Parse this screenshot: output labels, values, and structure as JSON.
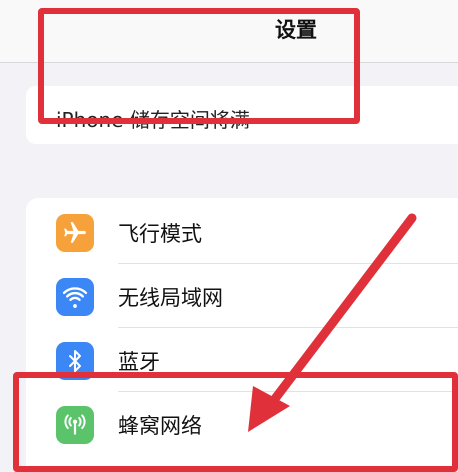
{
  "header": {
    "title": "设置"
  },
  "banner": {
    "text": "iPhone 储存空间将满"
  },
  "settings": {
    "items": [
      {
        "label": "飞行模式",
        "icon": "airplane-icon",
        "color": "#f7a13a"
      },
      {
        "label": "无线局域网",
        "icon": "wifi-icon",
        "color": "#3a87f5"
      },
      {
        "label": "蓝牙",
        "icon": "bluetooth-icon",
        "color": "#3a87f5"
      },
      {
        "label": "蜂窝网络",
        "icon": "cellular-icon",
        "color": "#5bc46a"
      }
    ]
  },
  "annotations": {
    "color": "#e0303a"
  }
}
